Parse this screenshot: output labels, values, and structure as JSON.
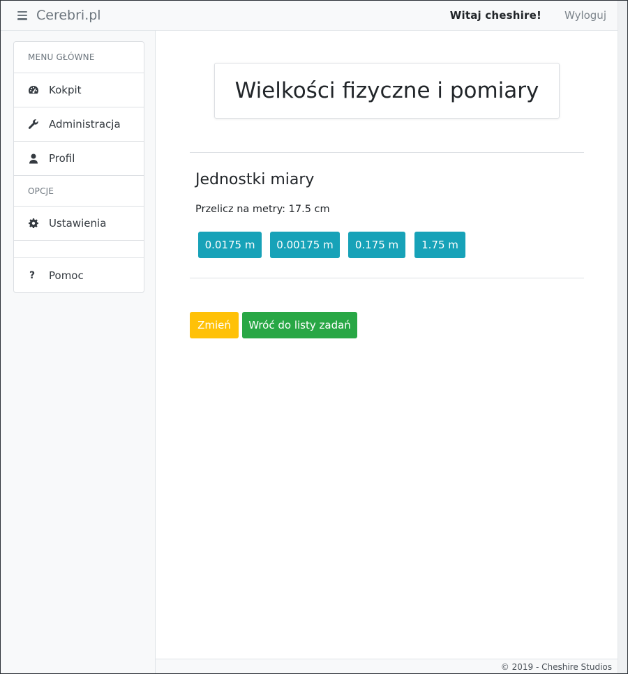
{
  "navbar": {
    "brand": "Cerebri.pl",
    "greeting": "Witaj cheshire!",
    "logout": "Wyloguj"
  },
  "sidebar": {
    "main_header": "MENU GŁÓWNE",
    "items": [
      {
        "label": "Kokpit",
        "icon": "tachometer-icon"
      },
      {
        "label": "Administracja",
        "icon": "wrench-icon"
      },
      {
        "label": "Profil",
        "icon": "user-icon"
      }
    ],
    "options_header": "OPCJE",
    "settings": {
      "label": "Ustawienia",
      "icon": "gear-icon"
    },
    "help": {
      "label": "Pomoc",
      "icon": "question-icon"
    }
  },
  "main": {
    "title": "Wielkości fizyczne i pomiary",
    "section_title": "Jednostki miary",
    "question": "Przelicz na metry: 17.5 cm",
    "answers": [
      "0.0175 m",
      "0.00175 m",
      "0.175 m",
      "1.75 m"
    ],
    "change_button": "Zmień",
    "back_button": "Wróć do listy zadań"
  },
  "footer": {
    "copyright": "© 2019 - Cheshire Studios"
  },
  "colors": {
    "info": "#17a2b8",
    "warning": "#ffc107",
    "success": "#28a745"
  }
}
